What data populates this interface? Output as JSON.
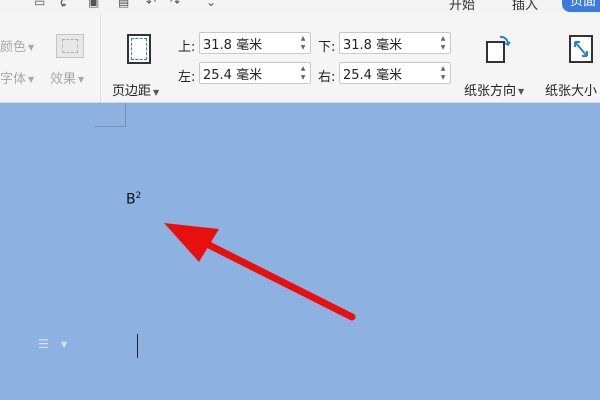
{
  "topbar": {
    "tabs": [
      "开始",
      "插入"
    ],
    "active_tab": "页面"
  },
  "ribbon": {
    "left_group": {
      "color_label": "颜色",
      "font_label": "字体",
      "effect_label": "效果"
    },
    "margins_button": {
      "label": "页边距"
    },
    "margins": {
      "top": {
        "label": "上:",
        "value": "31.8 毫米"
      },
      "bottom": {
        "label": "下:",
        "value": "31.8 毫米"
      },
      "left": {
        "label": "左:",
        "value": "25.4 毫米"
      },
      "right": {
        "label": "右:",
        "value": "25.4 毫米"
      }
    },
    "orientation_button": {
      "label": "纸张方向"
    },
    "size_button": {
      "label": "纸张大小"
    }
  },
  "document": {
    "text_base": "B",
    "text_superscript": "2"
  },
  "colors": {
    "canvas": "#8db2e2",
    "ribbon": "#f5f5f5",
    "active_tab": "#3b7be0",
    "arrow": "#e8100e"
  }
}
